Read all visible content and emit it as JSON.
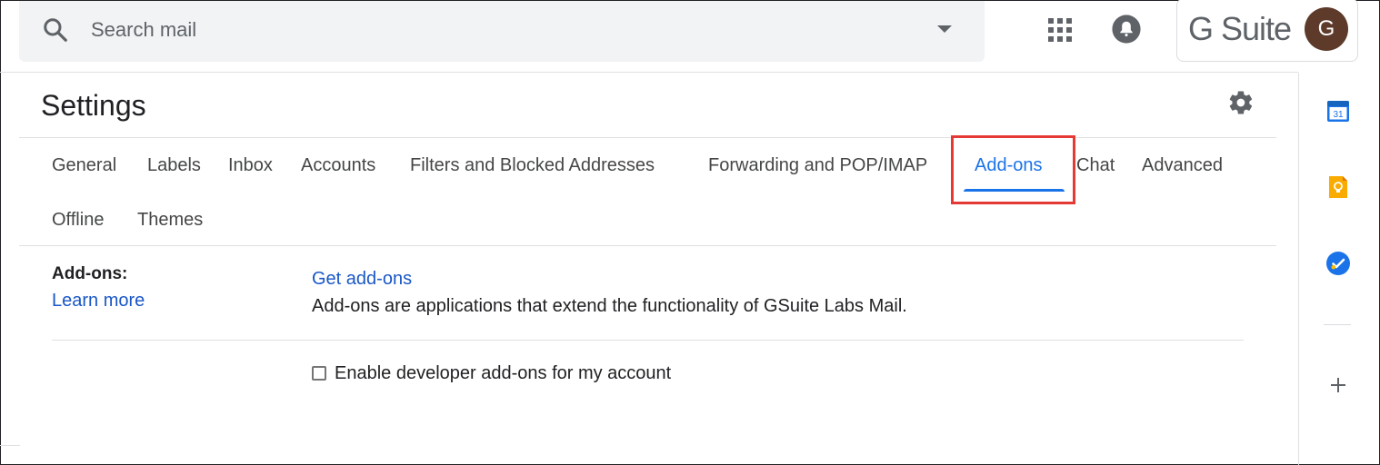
{
  "header": {
    "search_placeholder": "Search mail",
    "brand": "G Suite",
    "avatar_letter": "G"
  },
  "settings": {
    "title": "Settings",
    "tabs": [
      {
        "label": "General",
        "active": false
      },
      {
        "label": "Labels",
        "active": false
      },
      {
        "label": "Inbox",
        "active": false
      },
      {
        "label": "Accounts",
        "active": false
      },
      {
        "label": "Filters and Blocked Addresses",
        "active": false
      },
      {
        "label": "Forwarding and POP/IMAP",
        "active": false
      },
      {
        "label": "Add-ons",
        "active": true
      },
      {
        "label": "Chat",
        "active": false
      },
      {
        "label": "Advanced",
        "active": false
      },
      {
        "label": "Offline",
        "active": false
      },
      {
        "label": "Themes",
        "active": false
      }
    ]
  },
  "addons": {
    "section_label": "Add-ons:",
    "learn_more": "Learn more",
    "get_addons": "Get add-ons",
    "description": "Add-ons are applications that extend the functionality of GSuite Labs Mail.",
    "developer_checkbox_label": "Enable developer add-ons for my account",
    "developer_checkbox_checked": false
  },
  "side_panel": {
    "calendar_day": "31",
    "icons": [
      "calendar-icon",
      "keep-icon",
      "tasks-icon",
      "plus-icon"
    ]
  },
  "colors": {
    "accent": "#1a73e8",
    "link": "#1a57c6",
    "highlight": "#e53935",
    "avatar_bg": "#5d3a2a"
  }
}
